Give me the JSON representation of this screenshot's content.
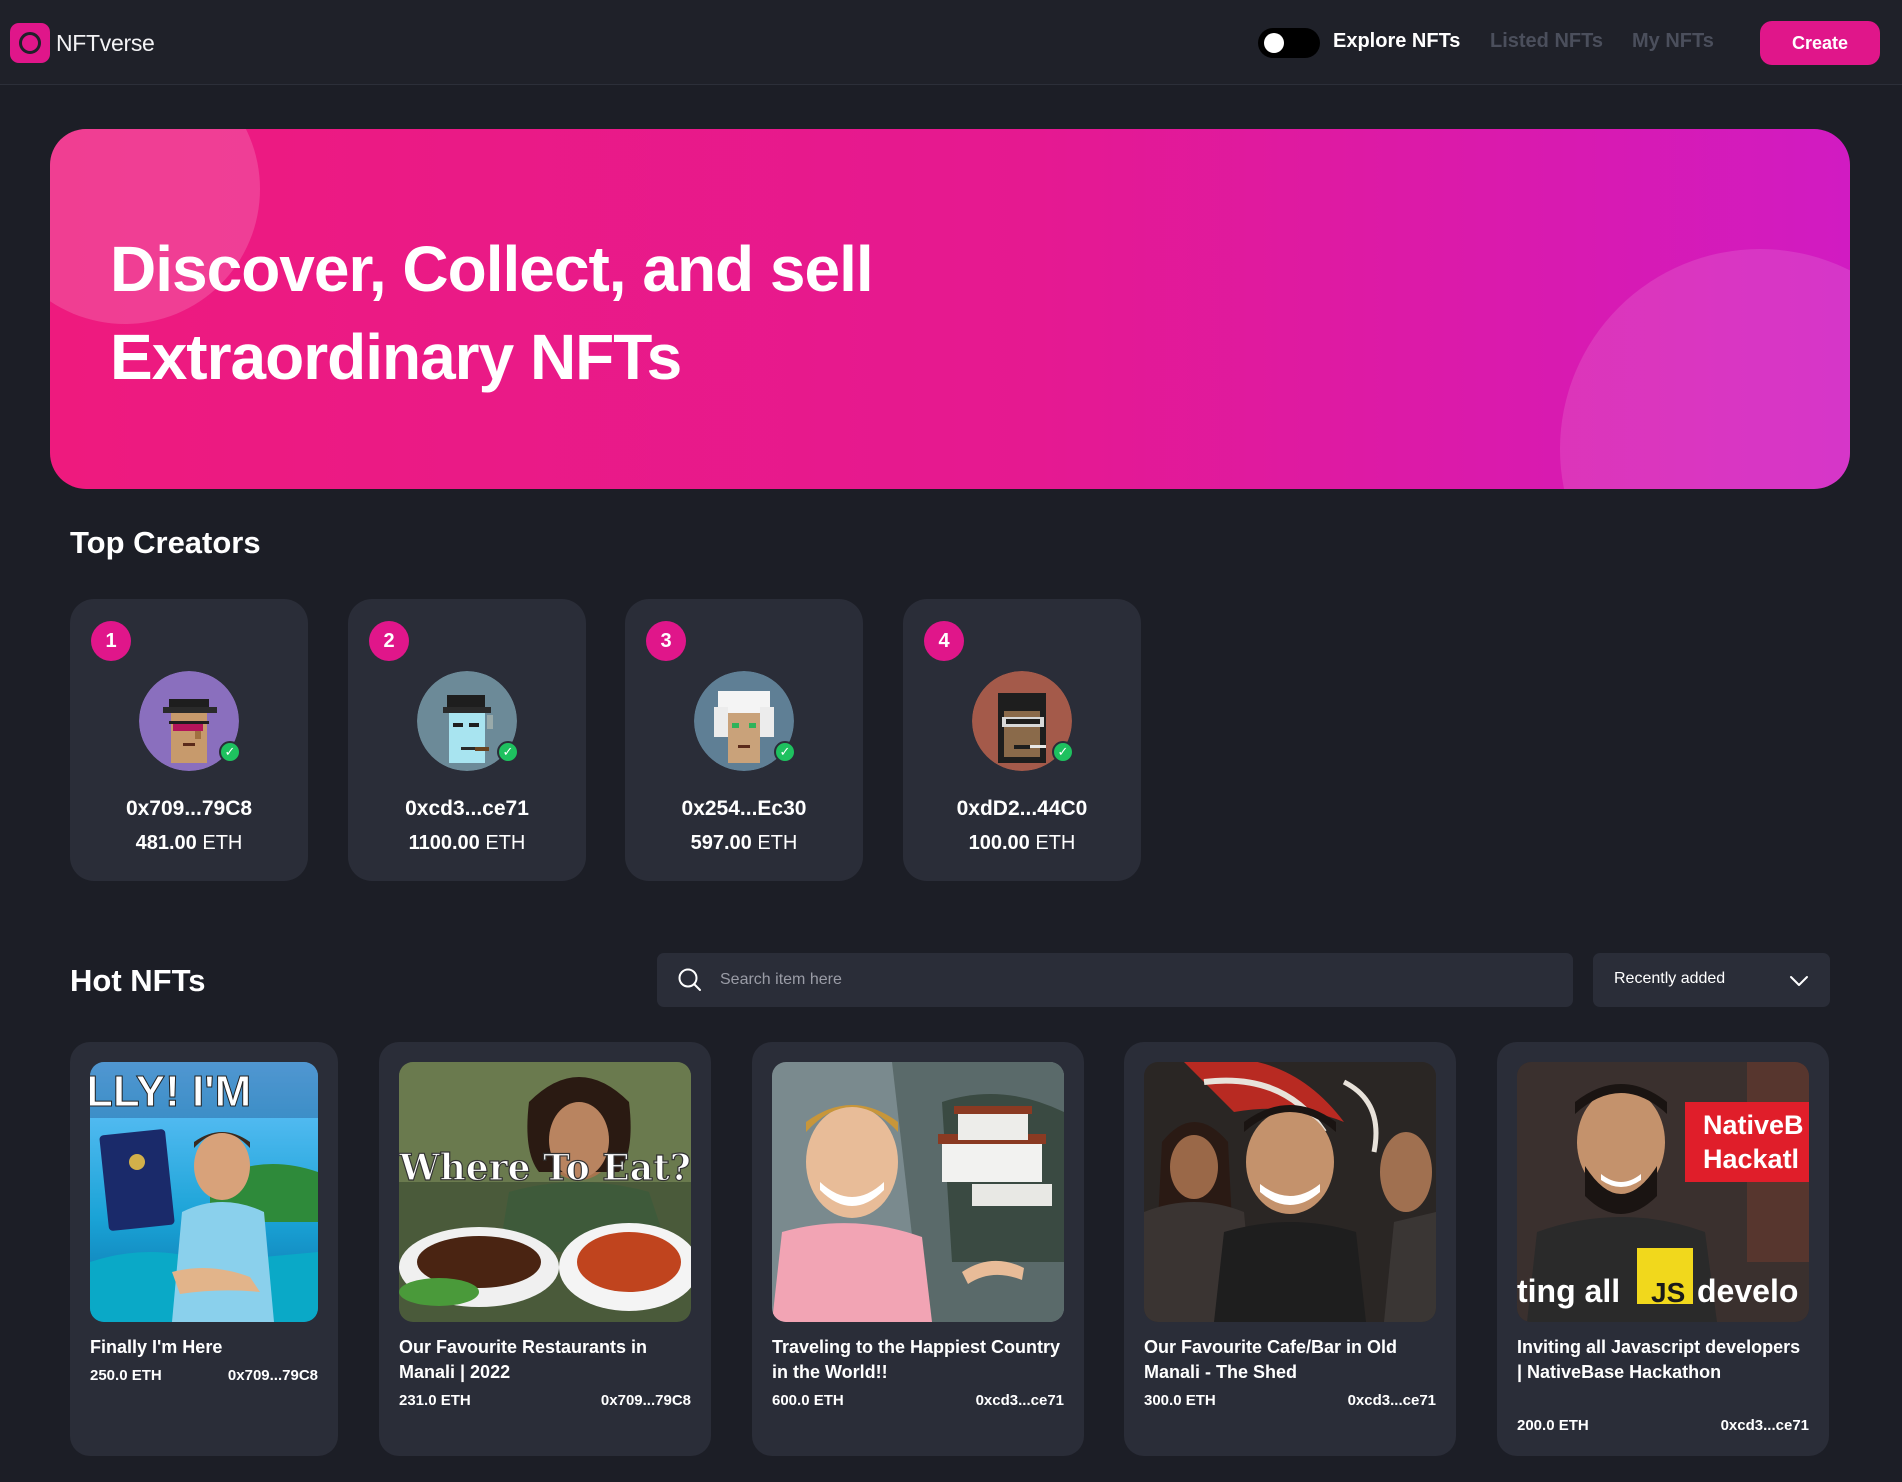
{
  "header": {
    "logo_text": "NFTverse",
    "nav": {
      "explore": "Explore NFTs",
      "listed": "Listed NFTs",
      "my": "My NFTs"
    },
    "create_label": "Create",
    "theme_toggle_on": false
  },
  "hero": {
    "title_line1": "Discover, Collect, and sell",
    "title_line2": "Extraordinary NFTs"
  },
  "top_creators": {
    "title": "Top Creators",
    "items": [
      {
        "rank": "1",
        "address": "0x709...79C8",
        "eth_value": "481.00",
        "eth_unit": "ETH",
        "avatar_bg": "#8a6fbe"
      },
      {
        "rank": "2",
        "address": "0xcd3...ce71",
        "eth_value": "1100.00",
        "eth_unit": "ETH",
        "avatar_bg": "#6c8a98"
      },
      {
        "rank": "3",
        "address": "0x254...Ec30",
        "eth_value": "597.00",
        "eth_unit": "ETH",
        "avatar_bg": "#5f7f95"
      },
      {
        "rank": "4",
        "address": "0xdD2...44C0",
        "eth_value": "100.00",
        "eth_unit": "ETH",
        "avatar_bg": "#a45a4a"
      }
    ]
  },
  "hot_nfts": {
    "title": "Hot NFTs",
    "search_placeholder": "Search item here",
    "sort_selected": "Recently added",
    "items": [
      {
        "title": "Finally I'm Here",
        "price": "250.0 ETH",
        "owner": "0x709...79C8",
        "thumb_text": "LLY! I'M"
      },
      {
        "title": "Our Favourite Restaurants in Manali | 2022",
        "price": "231.0 ETH",
        "owner": "0x709...79C8",
        "thumb_text": "Where To Eat?"
      },
      {
        "title": "Traveling to the Happiest Country in the World!!",
        "price": "600.0 ETH",
        "owner": "0xcd3...ce71",
        "thumb_text": ""
      },
      {
        "title": "Our Favourite Cafe/Bar in Old Manali - The Shed",
        "price": "300.0 ETH",
        "owner": "0xcd3...ce71",
        "thumb_text": ""
      },
      {
        "title": "Inviting all Javascript developers | NativeBase Hackathon",
        "price": "200.0 ETH",
        "owner": "0xcd3...ce71",
        "thumb_text_1": "NativeB",
        "thumb_text_2": "Hackatl",
        "thumb_text_3": "ting all",
        "thumb_badge": "JS",
        "thumb_text_4": "develo"
      }
    ]
  },
  "colors": {
    "accent": "#e0168a",
    "bg": "#1c1e26",
    "card": "#2a2d38",
    "verified": "#1ec15f"
  }
}
